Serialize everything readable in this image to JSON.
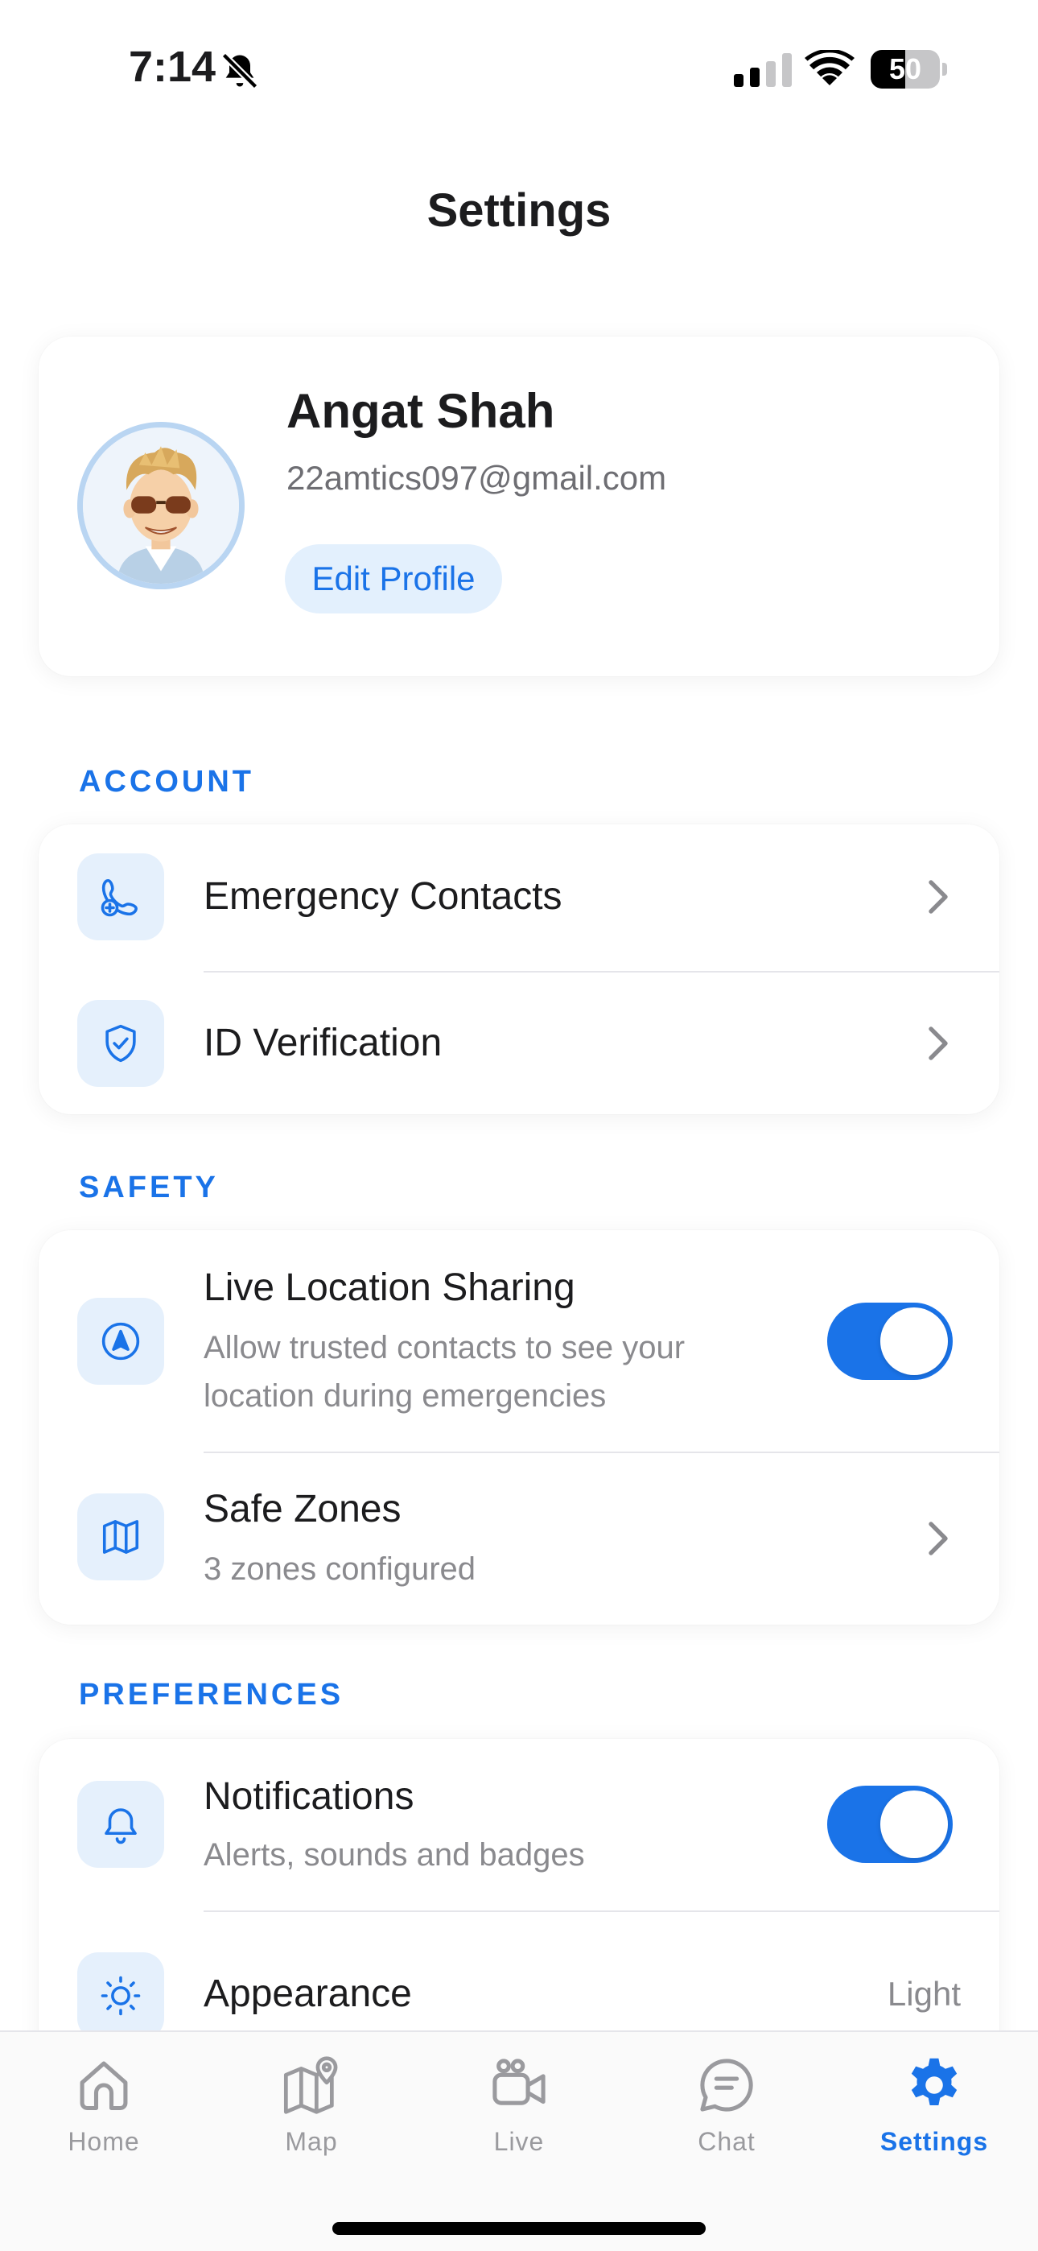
{
  "status_bar": {
    "time": "7:14",
    "battery_percent": "50",
    "battery_level": 0.5
  },
  "header": {
    "title": "Settings"
  },
  "profile": {
    "name": "Angat Shah",
    "email": "22amtics097@gmail.com",
    "edit_label": "Edit Profile",
    "avatar_icon": "memoji-avatar"
  },
  "sections": {
    "account": {
      "label": "ACCOUNT",
      "items": [
        {
          "title": "Emergency Contacts",
          "icon": "phone-plus-icon"
        },
        {
          "title": "ID Verification",
          "icon": "shield-check-icon"
        }
      ]
    },
    "safety": {
      "label": "SAFETY",
      "items": [
        {
          "title": "Live Location Sharing",
          "subtitle_line1": "Allow trusted contacts to see your",
          "subtitle_line2": "location during emergencies",
          "icon": "navigation-icon",
          "toggle_on": true
        },
        {
          "title": "Safe Zones",
          "subtitle": "3 zones configured",
          "icon": "map-icon"
        }
      ]
    },
    "preferences": {
      "label": "PREFERENCES",
      "items": [
        {
          "title": "Notifications",
          "subtitle": "Alerts, sounds and badges",
          "icon": "bell-icon",
          "toggle_on": true
        },
        {
          "title": "Appearance",
          "value": "Light",
          "icon": "sun-icon"
        }
      ]
    }
  },
  "tab_bar": {
    "tabs": [
      {
        "label": "Home",
        "icon": "home-icon",
        "active": false
      },
      {
        "label": "Map",
        "icon": "map-pin-icon",
        "active": false
      },
      {
        "label": "Live",
        "icon": "video-icon",
        "active": false
      },
      {
        "label": "Chat",
        "icon": "chat-icon",
        "active": false
      },
      {
        "label": "Settings",
        "icon": "gear-icon",
        "active": true
      }
    ]
  },
  "colors": {
    "accent": "#1a73e8",
    "icon_tile": "#e5f0fc",
    "secondary_text": "#8a8a8e"
  }
}
